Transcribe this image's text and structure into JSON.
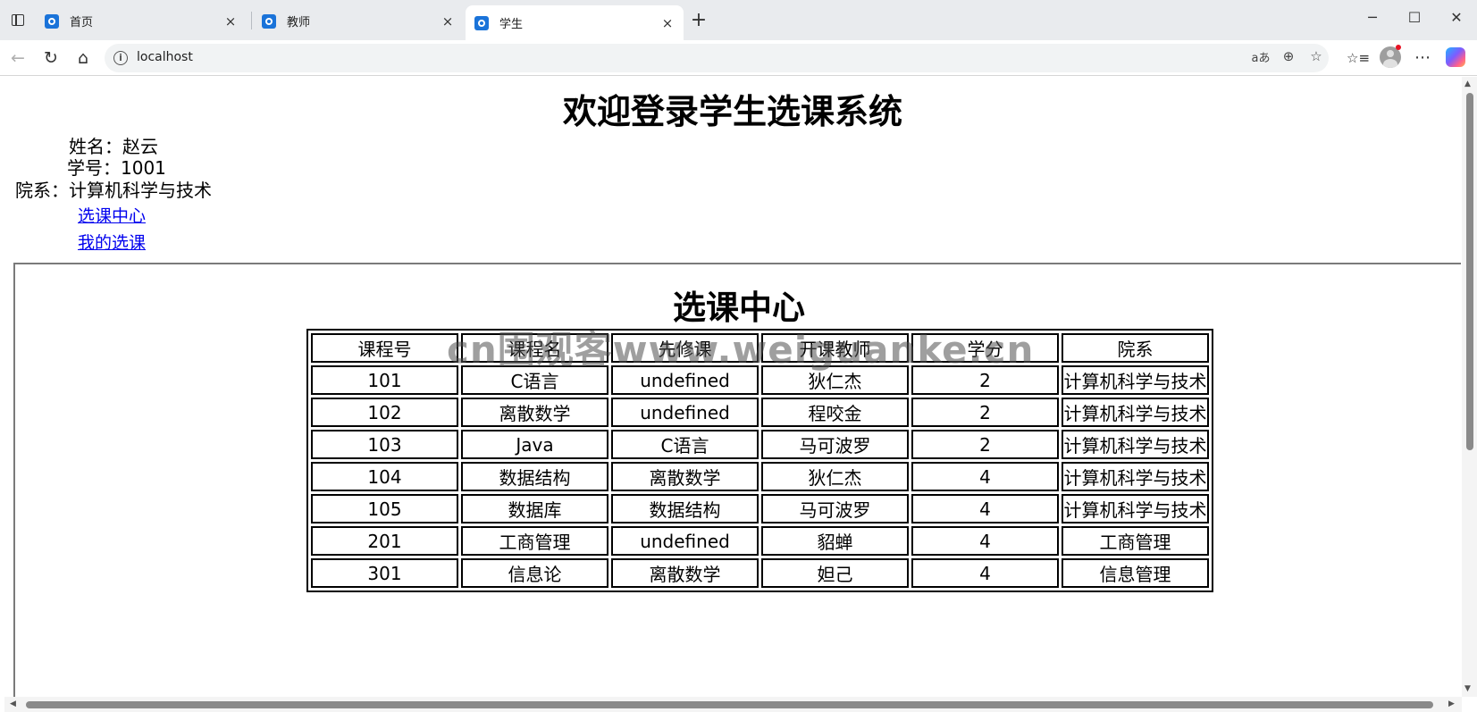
{
  "browser": {
    "tabs": [
      {
        "title": "首页",
        "active": false
      },
      {
        "title": "教师",
        "active": false
      },
      {
        "title": "学生",
        "active": true
      }
    ],
    "url": "localhost",
    "icons": {
      "sidebar_toggle": "tab-actions-icon",
      "favicon": "site-favicon-icon",
      "close": "×",
      "new_tab": "+",
      "back": "←",
      "refresh": "↻",
      "home": "⌂",
      "info": "i",
      "read_aloud": "aあ",
      "zoom": "⊕",
      "favorite": "☆",
      "favorites": "☆≡",
      "more": "⋯",
      "minimize": "─",
      "maximize": "☐",
      "window_close": "✕"
    }
  },
  "page": {
    "title": "欢迎登录学生选课系统",
    "student": {
      "name_label": "姓名：",
      "name": "赵云",
      "id_label": "学号：",
      "id": "1001",
      "dept_label": "院系：",
      "dept": "计算机科学与技术"
    },
    "nav": {
      "course_center": "选课中心",
      "my_courses": "我的选课"
    },
    "frame": {
      "title": "选课中心",
      "table": {
        "headers": [
          "课程号",
          "课程名",
          "先修课",
          "开课教师",
          "学分",
          "院系"
        ],
        "rows": [
          [
            "101",
            "C语言",
            "undefined",
            "狄仁杰",
            "2",
            "计算机科学与技术"
          ],
          [
            "102",
            "离散数学",
            "undefined",
            "程咬金",
            "2",
            "计算机科学与技术"
          ],
          [
            "103",
            "Java",
            "C语言",
            "马可波罗",
            "2",
            "计算机科学与技术"
          ],
          [
            "104",
            "数据结构",
            "离散数学",
            "狄仁杰",
            "4",
            "计算机科学与技术"
          ],
          [
            "105",
            "数据库",
            "数据结构",
            "马可波罗",
            "4",
            "计算机科学与技术"
          ],
          [
            "201",
            "工商管理",
            "undefined",
            "貂蝉",
            "4",
            "工商管理"
          ],
          [
            "301",
            "信息论",
            "离散数学",
            "妲己",
            "4",
            "信息管理"
          ]
        ]
      }
    },
    "watermark": "cn围观客www.weiguanke.cn"
  },
  "colors": {
    "link": "#0000ee",
    "favicon": "#1a73d9",
    "chrome_bg": "#e9ebee"
  }
}
